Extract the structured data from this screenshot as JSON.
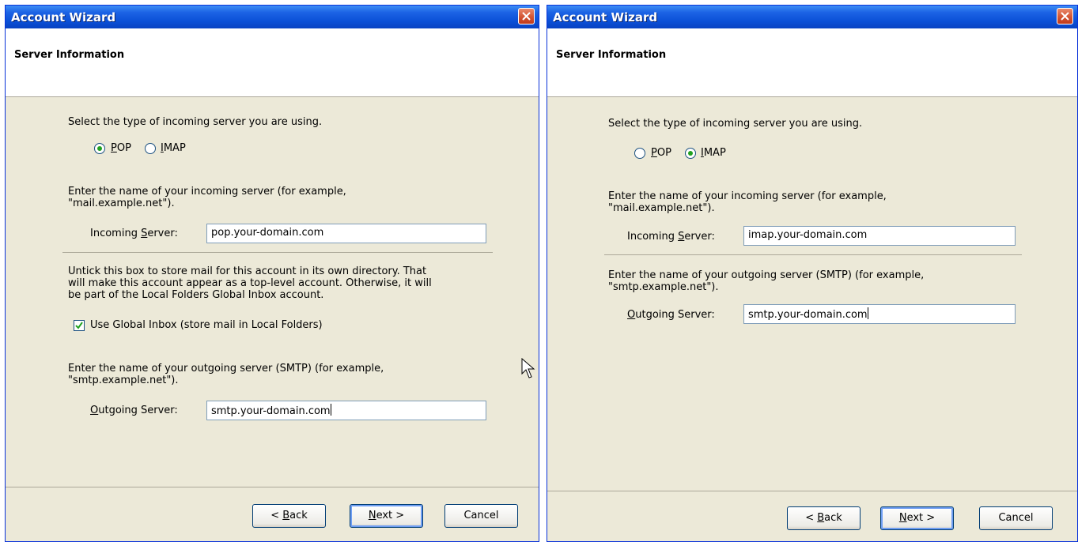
{
  "windows": [
    {
      "title": "Account Wizard",
      "section": "Server Information",
      "server_type_prompt": "Select the type of incoming server you are using.",
      "server_type_options": [
        "POP",
        "IMAP"
      ],
      "server_type_selected": "POP",
      "incoming_prompt_line1": "Enter the name of your incoming server (for example,",
      "incoming_prompt_line2": "\"mail.example.net\").",
      "incoming_label": "Incoming Server:",
      "incoming_value": "pop.your-domain.com",
      "global_inbox_line1": "Untick this box to store mail for this account in its own directory. That",
      "global_inbox_line2": "will make this account appear as a top-level account. Otherwise, it will",
      "global_inbox_line3": "be part of the Local Folders Global Inbox account.",
      "global_inbox_label": "Use Global Inbox (store mail in Local Folders)",
      "global_inbox_checked": true,
      "outgoing_prompt_line1": "Enter the name of your outgoing server (SMTP) (for example,",
      "outgoing_prompt_line2": "\"smtp.example.net\").",
      "outgoing_label": "Outgoing Server:",
      "outgoing_value": "smtp.your-domain.com",
      "buttons": {
        "back": "< Back",
        "next": "Next >",
        "cancel": "Cancel"
      }
    },
    {
      "title": "Account Wizard",
      "section": "Server Information",
      "server_type_prompt": "Select the type of incoming server you are using.",
      "server_type_options": [
        "POP",
        "IMAP"
      ],
      "server_type_selected": "IMAP",
      "incoming_prompt_line1": "Enter the name of your incoming server (for example,",
      "incoming_prompt_line2": "\"mail.example.net\").",
      "incoming_label": "Incoming Server:",
      "incoming_value": "imap.your-domain.com",
      "outgoing_prompt_line1": "Enter the name of your outgoing server (SMTP) (for example,",
      "outgoing_prompt_line2": "\"smtp.example.net\").",
      "outgoing_label": "Outgoing Server:",
      "outgoing_value": "smtp.your-domain.com",
      "buttons": {
        "back": "< Back",
        "next": "Next >",
        "cancel": "Cancel"
      }
    }
  ],
  "colors": {
    "titlebar": "#0a4fd6",
    "dialog_background": "#ece9d8",
    "radio_dot": "#21a121",
    "close_button": "#d35534"
  }
}
